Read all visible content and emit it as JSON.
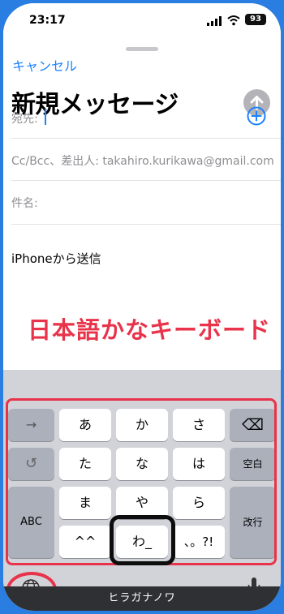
{
  "status_bar": {
    "time": "23:17",
    "battery": "93"
  },
  "compose": {
    "cancel_label": "キャンセル",
    "title": "新規メッセージ",
    "to_label": "宛先:",
    "cc_label": "Cc/Bcc、差出人: takahiro.kurikawa@gmail.com",
    "subject_label": "件名:",
    "body": "iPhoneから送信"
  },
  "annotation": "日本語かなキーボード",
  "keyboard": {
    "left": {
      "arrow": "→",
      "undo": "↺",
      "abc": "ABC"
    },
    "rows": [
      [
        "あ",
        "か",
        "さ"
      ],
      [
        "た",
        "な",
        "は"
      ],
      [
        "ま",
        "や",
        "ら"
      ],
      [
        "^^",
        "わ_",
        "、。?!"
      ]
    ],
    "right": {
      "delete": "⌫",
      "space": "空白",
      "enter": "改行"
    }
  },
  "banner": "ヒラガナノワ",
  "colors": {
    "accent": "#1a82ff",
    "annotation": "#e8334a",
    "frame": "#2a7de1"
  }
}
